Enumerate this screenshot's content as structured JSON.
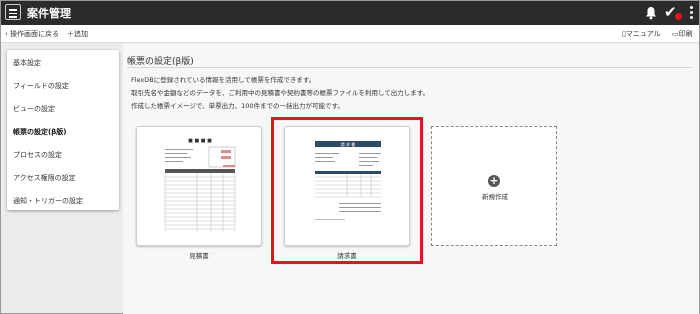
{
  "header": {
    "title": "案件管理"
  },
  "toolbar": {
    "back_label": "操作画面に戻る",
    "add_label": "追加",
    "manual_label": "マニュアル",
    "print_label": "印刷"
  },
  "sidebar": {
    "items": [
      {
        "label": "基本設定"
      },
      {
        "label": "フィールドの設定"
      },
      {
        "label": "ビューの設定"
      },
      {
        "label": "帳票の設定(β版)"
      },
      {
        "label": "プロセスの設定"
      },
      {
        "label": "アクセス権限の設定"
      },
      {
        "label": "通知・トリガーの設定"
      }
    ]
  },
  "main": {
    "title": "帳票の設定(β版)",
    "description": [
      "FlexDBに登録されている情報を活用して帳票を作成できます。",
      "取引先名や金額などのデータを、ご利用中の見積書や契約書等の帳票ファイルを利用して出力します。",
      "作成した帳票イメージで、単票出力、100件までの一括出力が可能です。"
    ],
    "templates": [
      {
        "label": "見積書",
        "doc_title": "■ ■ ■ ■"
      },
      {
        "label": "請求書",
        "doc_title": "請 求 書"
      }
    ],
    "new_label": "新規作成"
  },
  "colors": {
    "highlight": "#e0161e",
    "header_bg": "#2b2b2b",
    "invoice_bar": "#2f4a66"
  }
}
